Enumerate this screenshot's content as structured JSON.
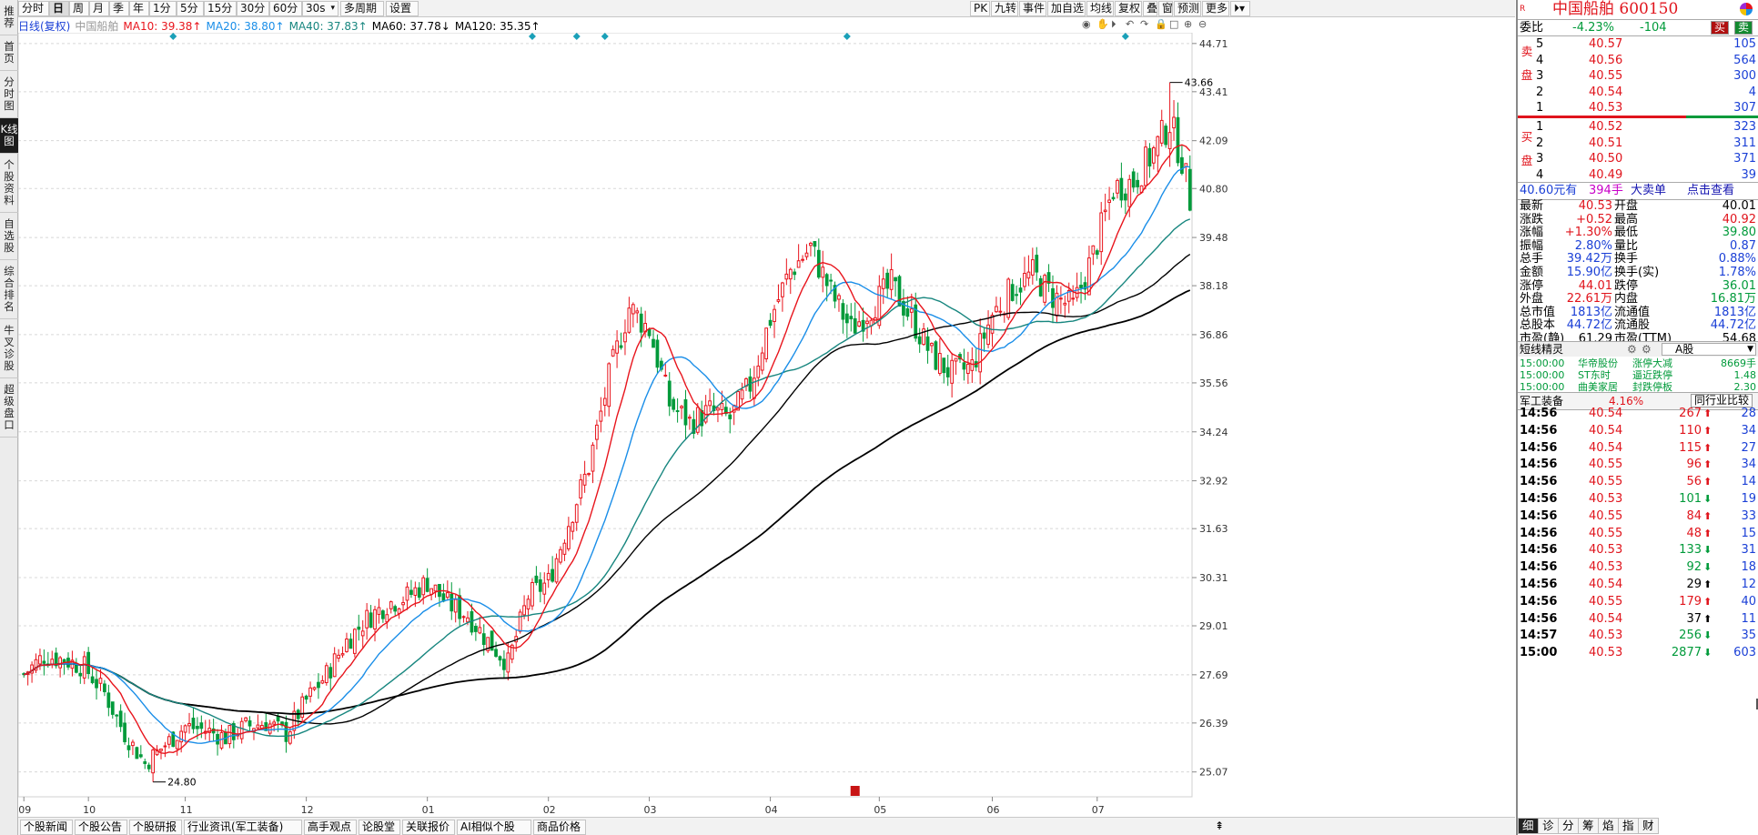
{
  "sidebar": [
    {
      "label": "推荐",
      "active": false
    },
    {
      "label": "首页",
      "active": false
    },
    {
      "label": "分时图",
      "active": false
    },
    {
      "label": "K线图",
      "active": true
    },
    {
      "label": "个股资料",
      "active": false
    },
    {
      "label": "自选股",
      "active": false
    },
    {
      "label": "综合排名",
      "active": false
    },
    {
      "label": "牛叉诊股",
      "active": false
    },
    {
      "label": "超级盘口",
      "active": false
    }
  ],
  "toolbar": {
    "periods": [
      "分时",
      "日",
      "周",
      "月",
      "季",
      "年",
      "1分",
      "5分",
      "15分",
      "30分",
      "60分"
    ],
    "period_active": "日",
    "select_value": "30s",
    "multi_label": "多周期",
    "settings_label": "设置",
    "right_items": [
      "PK",
      "九转",
      "事件",
      "加自选",
      "均线",
      "复权",
      "叠",
      "窗",
      "预测",
      "更多"
    ]
  },
  "legend": {
    "mode": "日线(复权)",
    "name": "中国船舶",
    "ma": [
      {
        "label": "MA10: 39.38↑",
        "color": "#e8141c"
      },
      {
        "label": "MA20: 38.80↑",
        "color": "#1a8ee8"
      },
      {
        "label": "MA40: 37.83↑",
        "color": "#17867f"
      },
      {
        "label": "MA60: 37.78↓",
        "color": "#000000"
      },
      {
        "label": "MA120: 35.35↑",
        "color": "#000000"
      }
    ]
  },
  "chart_data": {
    "type": "candlestick",
    "ylim": [
      24.4,
      45.0
    ],
    "y_ticks": [
      "44.71",
      "43.41",
      "42.09",
      "40.80",
      "39.48",
      "38.18",
      "36.86",
      "35.56",
      "34.24",
      "32.92",
      "31.63",
      "30.31",
      "29.01",
      "27.69",
      "26.39",
      "25.07"
    ],
    "x_ticks": [
      "09",
      "10",
      "11",
      "12",
      "01",
      "02",
      "03",
      "04",
      "05",
      "06",
      "07"
    ],
    "x_tick_index": [
      0,
      16,
      40,
      70,
      100,
      130,
      155,
      185,
      212,
      240,
      266
    ],
    "n_bars": 290,
    "annotations": {
      "high": "43.66",
      "low": "24.80",
      "high_index": 284,
      "low_index": 32
    },
    "event_marker_index": [
      37,
      126,
      137,
      144,
      204,
      273
    ],
    "close_anchors": [
      [
        0,
        27.7
      ],
      [
        5,
        28.2
      ],
      [
        10,
        28.1
      ],
      [
        15,
        27.9
      ],
      [
        20,
        27.2
      ],
      [
        25,
        26.1
      ],
      [
        30,
        25.3
      ],
      [
        35,
        25.8
      ],
      [
        40,
        26.3
      ],
      [
        45,
        26.2
      ],
      [
        50,
        26.0
      ],
      [
        55,
        26.3
      ],
      [
        60,
        26.4
      ],
      [
        65,
        26.1
      ],
      [
        70,
        27.0
      ],
      [
        75,
        27.7
      ],
      [
        80,
        28.6
      ],
      [
        85,
        29.2
      ],
      [
        90,
        29.6
      ],
      [
        95,
        29.8
      ],
      [
        100,
        30.2
      ],
      [
        105,
        29.6
      ],
      [
        110,
        29.3
      ],
      [
        115,
        28.6
      ],
      [
        120,
        28.0
      ],
      [
        125,
        29.8
      ],
      [
        130,
        30.2
      ],
      [
        135,
        31.8
      ],
      [
        140,
        33.3
      ],
      [
        145,
        35.7
      ],
      [
        150,
        37.6
      ],
      [
        155,
        37.0
      ],
      [
        160,
        35.0
      ],
      [
        165,
        34.5
      ],
      [
        170,
        34.8
      ],
      [
        175,
        34.6
      ],
      [
        180,
        35.5
      ],
      [
        185,
        37.3
      ],
      [
        190,
        38.6
      ],
      [
        195,
        39.2
      ],
      [
        200,
        38.0
      ],
      [
        205,
        37.0
      ],
      [
        210,
        37.6
      ],
      [
        215,
        38.2
      ],
      [
        220,
        37.3
      ],
      [
        225,
        36.3
      ],
      [
        230,
        35.8
      ],
      [
        235,
        36.0
      ],
      [
        240,
        37.4
      ],
      [
        245,
        38.1
      ],
      [
        250,
        38.5
      ],
      [
        255,
        37.9
      ],
      [
        260,
        37.6
      ],
      [
        265,
        39.0
      ],
      [
        270,
        40.8
      ],
      [
        275,
        41.0
      ],
      [
        280,
        41.8
      ],
      [
        284,
        42.6
      ],
      [
        287,
        41.6
      ],
      [
        289,
        40.5
      ]
    ],
    "ma10_last": "39.38",
    "ma20_last": "38.80",
    "ma40_last": "37.83",
    "ma60_last": "37.78",
    "ma120_last": "35.35"
  },
  "bottom_tabs": [
    "个股新闻",
    "个股公告",
    "个股研报",
    "行业资讯(军工装备)",
    "高手观点",
    "论股堂",
    "关联报价",
    "AI相似个股",
    "商品价格"
  ],
  "quote": {
    "badge": "R",
    "name": "中国船舶 600150",
    "webi_label": "委比",
    "webi_pct": "-4.23%",
    "webi_val": "-104",
    "sell_btn": "买",
    "buy_btn": "卖",
    "sell_side_label": "卖盘",
    "buy_side_label": "买盘",
    "asks": [
      {
        "lvl": "5",
        "price": "40.57",
        "vol": "105"
      },
      {
        "lvl": "4",
        "price": "40.56",
        "vol": "564"
      },
      {
        "lvl": "3",
        "price": "40.55",
        "vol": "300"
      },
      {
        "lvl": "2",
        "price": "40.54",
        "vol": "4"
      },
      {
        "lvl": "1",
        "price": "40.53",
        "vol": "307"
      }
    ],
    "bids": [
      {
        "lvl": "1",
        "price": "40.52",
        "vol": "323"
      },
      {
        "lvl": "2",
        "price": "40.51",
        "vol": "311"
      },
      {
        "lvl": "3",
        "price": "40.50",
        "vol": "371"
      },
      {
        "lvl": "4",
        "price": "40.49",
        "vol": "39"
      }
    ],
    "bigline": {
      "price": "40.60元有",
      "qty": "394手",
      "label": "大卖单",
      "link": "点击查看"
    },
    "stats": [
      {
        "l": "最新",
        "lv": "40.53",
        "lc": "red",
        "r": "开盘",
        "rv": "40.01",
        "rc": "black"
      },
      {
        "l": "涨跌",
        "lv": "+0.52",
        "lc": "red",
        "r": "最高",
        "rv": "40.92",
        "rc": "red"
      },
      {
        "l": "涨幅",
        "lv": "+1.30%",
        "lc": "red",
        "r": "最低",
        "rv": "39.80",
        "rc": "green"
      },
      {
        "l": "振幅",
        "lv": "2.80%",
        "lc": "blue",
        "r": "量比",
        "rv": "0.87",
        "rc": "blue"
      },
      {
        "l": "总手",
        "lv": "39.42万",
        "lc": "blue",
        "r": "换手",
        "rv": "0.88%",
        "rc": "blue"
      },
      {
        "l": "金额",
        "lv": "15.90亿",
        "lc": "blue",
        "r": "换手(实)",
        "rv": "1.78%",
        "rc": "blue"
      },
      {
        "l": "涨停",
        "lv": "44.01",
        "lc": "red",
        "r": "跌停",
        "rv": "36.01",
        "rc": "green"
      },
      {
        "l": "外盘",
        "lv": "22.61万",
        "lc": "red",
        "r": "内盘",
        "rv": "16.81万",
        "rc": "green"
      },
      {
        "l": "总市值",
        "lv": "1813亿",
        "lc": "blue",
        "r": "流通值",
        "rv": "1813亿",
        "rc": "blue"
      },
      {
        "l": "总股本",
        "lv": "44.72亿",
        "lc": "blue",
        "r": "流通股",
        "rv": "44.72亿",
        "rc": "blue"
      },
      {
        "l": "市盈(静)",
        "lv": "61.29",
        "lc": "black",
        "r": "市盈(TTM)",
        "rv": "54.68",
        "rc": "black"
      }
    ],
    "short_title": "短线精灵",
    "short_sel": "A股",
    "short_rows": [
      {
        "t": "15:00:00",
        "n": "华帝股份",
        "e": "涨停大减",
        "v": "8669手"
      },
      {
        "t": "15:00:00",
        "n": "ST东时",
        "e": "逼近跌停",
        "v": "1.48"
      },
      {
        "t": "15:00:00",
        "n": "曲美家居",
        "e": "封跌停板",
        "v": "2.30"
      }
    ],
    "industry": {
      "name": "军工装备",
      "pct": "4.16%",
      "btn": "同行业比较"
    },
    "ticks": [
      {
        "t": "14:56",
        "p": "40.54",
        "v": "267",
        "d": "up",
        "n": "28"
      },
      {
        "t": "14:56",
        "p": "40.54",
        "v": "110",
        "d": "up",
        "n": "34"
      },
      {
        "t": "14:56",
        "p": "40.54",
        "v": "115",
        "d": "up",
        "n": "27"
      },
      {
        "t": "14:56",
        "p": "40.55",
        "v": "96",
        "d": "up",
        "n": "34"
      },
      {
        "t": "14:56",
        "p": "40.55",
        "v": "56",
        "d": "up",
        "n": "14"
      },
      {
        "t": "14:56",
        "p": "40.53",
        "v": "101",
        "d": "down",
        "n": "19"
      },
      {
        "t": "14:56",
        "p": "40.55",
        "v": "84",
        "d": "up",
        "n": "33"
      },
      {
        "t": "14:56",
        "p": "40.55",
        "v": "48",
        "d": "up",
        "n": "15"
      },
      {
        "t": "14:56",
        "p": "40.53",
        "v": "133",
        "d": "down",
        "n": "31"
      },
      {
        "t": "14:56",
        "p": "40.53",
        "v": "92",
        "d": "down",
        "n": "18"
      },
      {
        "t": "14:56",
        "p": "40.54",
        "v": "29",
        "d": "up2",
        "n": "12"
      },
      {
        "t": "14:56",
        "p": "40.55",
        "v": "179",
        "d": "up",
        "n": "40"
      },
      {
        "t": "14:56",
        "p": "40.54",
        "v": "37",
        "d": "up2",
        "n": "11"
      },
      {
        "t": "14:57",
        "p": "40.53",
        "v": "256",
        "d": "down",
        "n": "35"
      },
      {
        "t": "15:00",
        "p": "40.53",
        "v": "2877",
        "d": "down",
        "n": "603"
      }
    ],
    "bottom_tabs": [
      "细",
      "诊",
      "分",
      "筹",
      "焰",
      "指",
      "财"
    ]
  }
}
